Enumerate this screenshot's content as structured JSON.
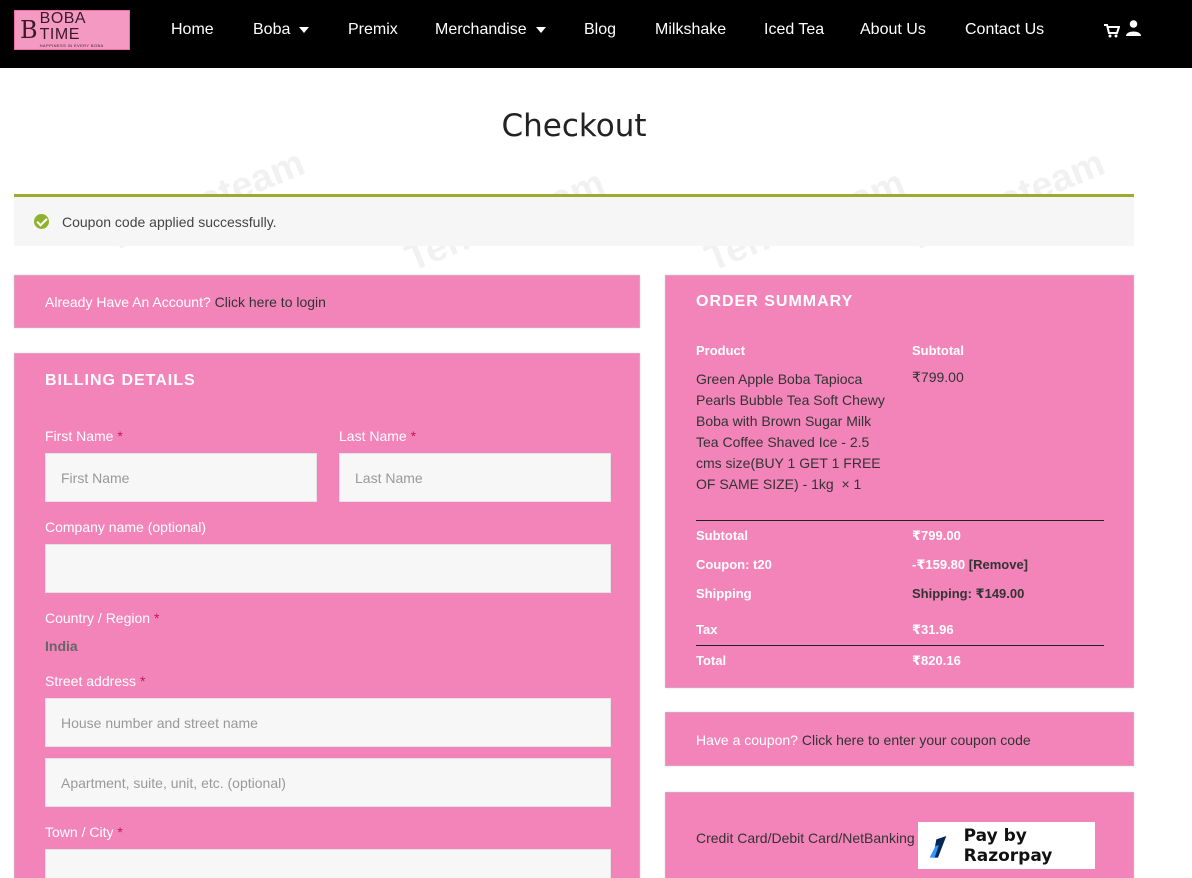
{
  "header": {
    "logo": {
      "mark": "B",
      "title": "BOBA TIME",
      "tagline": "HAPPINESS IN EVERY BOBA"
    },
    "nav": [
      {
        "label": "Home",
        "dropdown": false
      },
      {
        "label": "Boba",
        "dropdown": true
      },
      {
        "label": "Premix",
        "dropdown": false
      },
      {
        "label": "Merchandise",
        "dropdown": true
      },
      {
        "label": "Blog",
        "dropdown": false
      },
      {
        "label": "Milkshake",
        "dropdown": false
      },
      {
        "label": "Iced Tea",
        "dropdown": false
      },
      {
        "label": "About Us",
        "dropdown": false
      },
      {
        "label": "Contact Us",
        "dropdown": false
      }
    ],
    "icons": [
      "cart-icon",
      "user-icon"
    ]
  },
  "watermark": "Tenereteam",
  "page_title": "Checkout",
  "notice": {
    "text": "Coupon code applied successfully.",
    "icon": "check-circle-icon",
    "accent": "#9aab2f"
  },
  "login_bar": {
    "prefix": "Already Have An Account?",
    "link": "Click here to login"
  },
  "billing": {
    "heading": "BILLING DETAILS",
    "first_name": {
      "label": "First Name",
      "required": "*",
      "placeholder": "First Name",
      "value": ""
    },
    "last_name": {
      "label": "Last Name",
      "required": "*",
      "placeholder": "Last Name",
      "value": ""
    },
    "company": {
      "label": "Company name (optional)",
      "value": ""
    },
    "country": {
      "label": "Country / Region",
      "required": "*",
      "value": "India"
    },
    "street": {
      "label": "Street address",
      "required": "*",
      "placeholder1": "House number and street name",
      "placeholder2": "Apartment, suite, unit, etc. (optional)"
    },
    "city": {
      "label": "Town / City",
      "required": "*",
      "value": ""
    }
  },
  "summary": {
    "heading": "ORDER SUMMARY",
    "col_product": "Product",
    "col_subtotal": "Subtotal",
    "item": {
      "name": "Green Apple Boba Tapioca Pearls Bubble Tea Soft Chewy Boba with Brown Sugar Milk Tea Coffee Shaved Ice - 2.5 cms size(BUY 1 GET 1 FREE OF SAME SIZE) - 1kg",
      "qty": "× 1",
      "price": "₹799.00"
    },
    "subtotal": {
      "label": "Subtotal",
      "value": "₹799.00"
    },
    "coupon": {
      "label": "Coupon: t20",
      "value": "-₹159.80",
      "remove": "[Remove]"
    },
    "shipping": {
      "label": "Shipping",
      "value": "Shipping: ₹149.00"
    },
    "tax": {
      "label": "Tax",
      "value": "₹31.96"
    },
    "total": {
      "label": "Total",
      "value": "₹820.16"
    }
  },
  "coupon_bar": {
    "prefix": "Have a coupon?",
    "link": "Click here to enter your coupon code"
  },
  "payment": {
    "method": "Credit Card/Debit Card/NetBanking",
    "badge": "Pay by Razorpay"
  },
  "colors": {
    "pink": "#f284ba",
    "header": "#000000",
    "accent_green": "#9aab2f",
    "required": "#c2185b"
  }
}
